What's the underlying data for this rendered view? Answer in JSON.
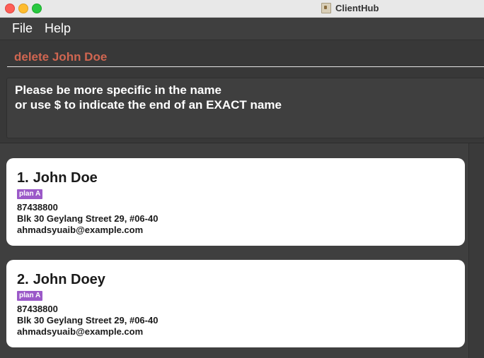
{
  "window": {
    "title": "ClientHub",
    "icon": "app-icon"
  },
  "menu": {
    "items": [
      {
        "label": "File"
      },
      {
        "label": "Help"
      }
    ]
  },
  "command": {
    "value": "delete John Doe",
    "color": "#d06651"
  },
  "result": {
    "lines": [
      "Please be more specific in the name",
      "or use $ to indicate the end of an EXACT name"
    ]
  },
  "clients": [
    {
      "index": "1.",
      "name": "John Doe",
      "tag": "plan A",
      "phone": "87438800",
      "address": "Blk 30 Geylang Street 29, #06-40",
      "email": "ahmadsyuaib@example.com"
    },
    {
      "index": "2.",
      "name": "John Doey",
      "tag": "plan A",
      "phone": "87438800",
      "address": "Blk 30 Geylang Street 29, #06-40",
      "email": "ahmadsyuaib@example.com"
    }
  ],
  "colors": {
    "tag_bg": "#9b59c8",
    "background": "#3f3f3f",
    "card_bg": "#ffffff"
  }
}
